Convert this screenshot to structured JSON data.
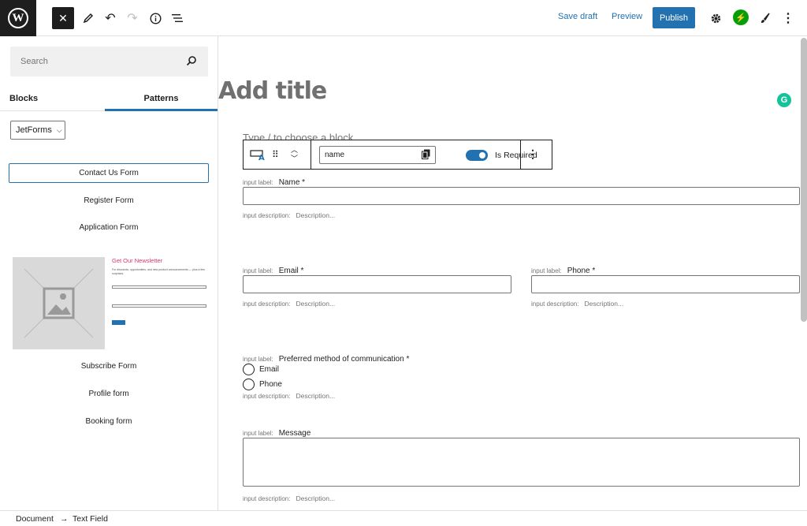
{
  "topbar": {
    "logo": "W",
    "save_draft": "Save draft",
    "preview": "Preview",
    "publish": "Publish"
  },
  "sidebar": {
    "search_placeholder": "Search",
    "tabs": [
      "Blocks",
      "Patterns"
    ],
    "category": "JetForms",
    "patterns": [
      "Contact Us Form",
      "Register Form",
      "Application Form",
      "Subscribe Form",
      "Profile form",
      "Booking form"
    ],
    "preview": {
      "title": "Get Our Newsletter",
      "text": "For discounts, opportunities, and new product announcements — plus a few surprises."
    }
  },
  "editor": {
    "title_placeholder": "Add title",
    "type_hint": "Type / to choose a block",
    "toolbar": {
      "field_name": "name",
      "required_label": "Is Required"
    },
    "labels": {
      "input_label": "input label:",
      "input_description": "input description:",
      "description_placeholder": "Description..."
    },
    "fields": {
      "name": "Name *",
      "email": "Email *",
      "phone": "Phone *",
      "preferred": "Preferred method of communication *",
      "message": "Message"
    },
    "radio_options": [
      "Email",
      "Phone"
    ]
  },
  "breadcrumb": {
    "document": "Document",
    "arrow": "→",
    "current": "Text Field"
  }
}
